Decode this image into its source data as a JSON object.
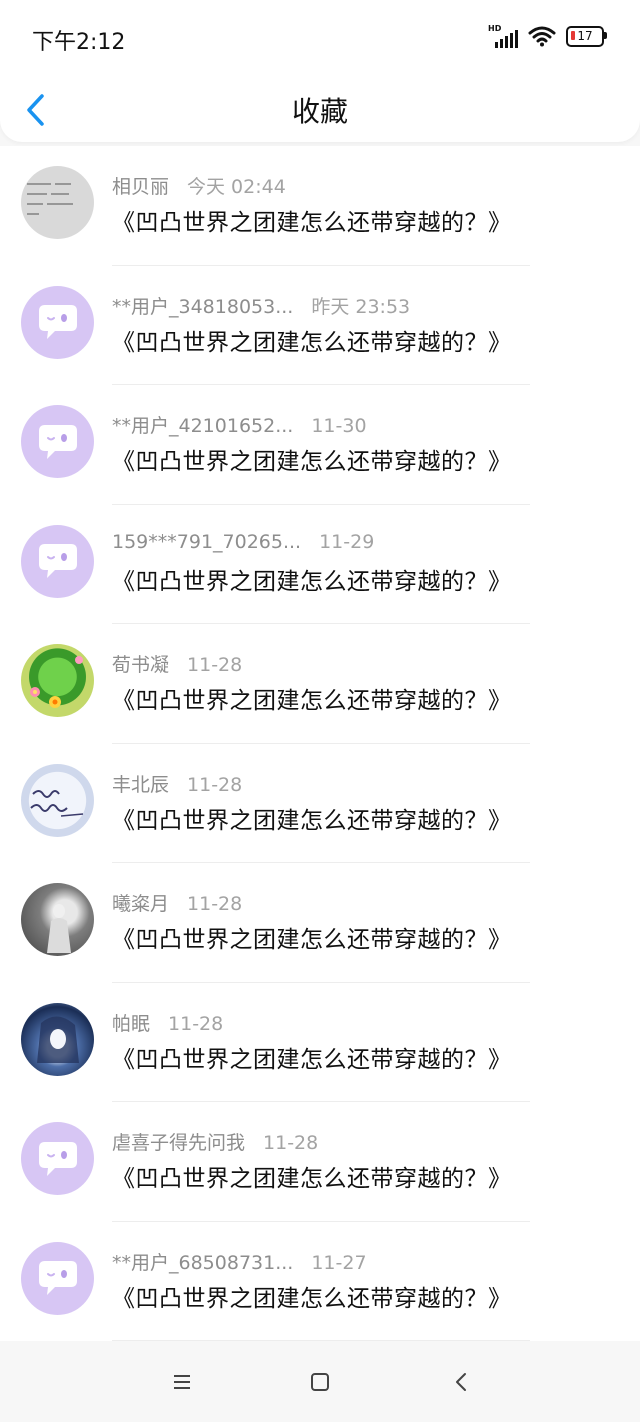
{
  "status": {
    "time": "下午2:12",
    "battery": "17",
    "signal_label": "HD"
  },
  "header": {
    "title": "收藏"
  },
  "colors": {
    "accent": "#1a93f0",
    "default_avatar": "#d7c6f4"
  },
  "items": [
    {
      "user": "相贝丽",
      "date": "今天 02:44",
      "title": "《凹凸世界之团建怎么还带穿越的？》",
      "avatar": "text-avatar"
    },
    {
      "user": "**用户_34818053...",
      "date": "昨天 23:53",
      "title": "《凹凸世界之团建怎么还带穿越的？》",
      "avatar": "default-avatar"
    },
    {
      "user": "**用户_42101652...",
      "date": "11-30",
      "title": "《凹凸世界之团建怎么还带穿越的？》",
      "avatar": "default-avatar"
    },
    {
      "user": "159***791_70265...",
      "date": "11-29",
      "title": "《凹凸世界之团建怎么还带穿越的？》",
      "avatar": "default-avatar"
    },
    {
      "user": "荀书凝",
      "date": "11-28",
      "title": "《凹凸世界之团建怎么还带穿越的？》",
      "avatar": "photo-avatar"
    },
    {
      "user": "丰北辰",
      "date": "11-28",
      "title": "《凹凸世界之团建怎么还带穿越的？》",
      "avatar": "photo-avatar"
    },
    {
      "user": "曦粢月",
      "date": "11-28",
      "title": "《凹凸世界之团建怎么还带穿越的？》",
      "avatar": "photo-avatar"
    },
    {
      "user": "帕眠",
      "date": "11-28",
      "title": "《凹凸世界之团建怎么还带穿越的？》",
      "avatar": "photo-avatar"
    },
    {
      "user": "虐喜子得先问我",
      "date": "11-28",
      "title": "《凹凸世界之团建怎么还带穿越的？》",
      "avatar": "default-avatar"
    },
    {
      "user": "**用户_68508731...",
      "date": "11-27",
      "title": "《凹凸世界之团建怎么还带穿越的？》",
      "avatar": "default-avatar"
    }
  ],
  "navbar": {
    "icons": [
      "menu-icon",
      "home-square-icon",
      "back-triangle-icon"
    ]
  }
}
